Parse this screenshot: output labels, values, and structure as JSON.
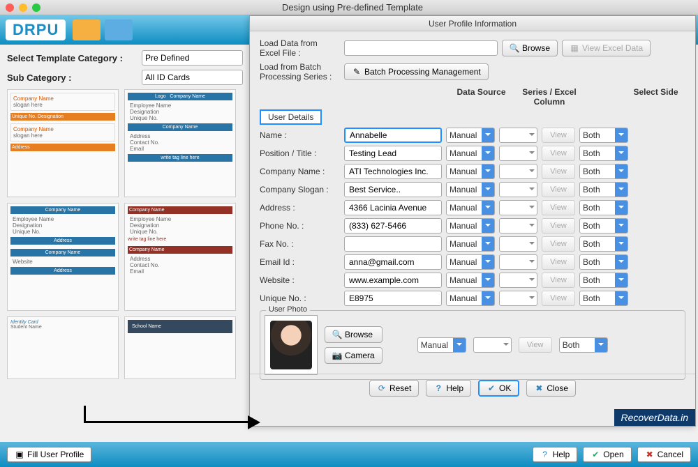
{
  "window": {
    "title": "Design using Pre-defined Template"
  },
  "header": {
    "logo": "DRPU"
  },
  "left": {
    "template_category_label": "Select Template Category :",
    "template_category_value": "Pre Defined",
    "sub_category_label": "Sub Category :",
    "sub_category_value": "All ID Cards"
  },
  "sheet": {
    "title": "User Profile Information",
    "load_excel_label": "Load Data from Excel File :",
    "browse": "Browse",
    "view_excel": "View Excel Data",
    "load_batch_label": "Load from Batch Processing Series :",
    "batch_btn": "Batch Processing Management",
    "user_details_tab": "User Details",
    "headers": {
      "data_source": "Data Source",
      "series_col": "Series / Excel Column",
      "select_side": "Select Side"
    },
    "manual": "Manual",
    "view": "View",
    "both": "Both",
    "fields": [
      {
        "label": "Name :",
        "value": "Annabelle"
      },
      {
        "label": "Position / Title :",
        "value": "Testing Lead"
      },
      {
        "label": "Company Name :",
        "value": "ATI Technologies Inc."
      },
      {
        "label": "Company Slogan :",
        "value": "Best Service.."
      },
      {
        "label": "Address :",
        "value": "4366 Lacinia Avenue"
      },
      {
        "label": "Phone No. :",
        "value": "(833) 627-5466"
      },
      {
        "label": "Fax No. :",
        "value": ""
      },
      {
        "label": "Email Id :",
        "value": "anna@gmail.com"
      },
      {
        "label": "Website :",
        "value": "www.example.com"
      },
      {
        "label": "Unique No. :",
        "value": "E8975"
      }
    ],
    "photo_legend": "User Photo",
    "camera": "Camera",
    "reset": "Reset",
    "help": "Help",
    "ok": "OK",
    "close": "Close"
  },
  "footer": {
    "fill_profile": "Fill User Profile",
    "help": "Help",
    "open": "Open",
    "cancel": "Cancel"
  },
  "watermark": "RecoverData.in"
}
